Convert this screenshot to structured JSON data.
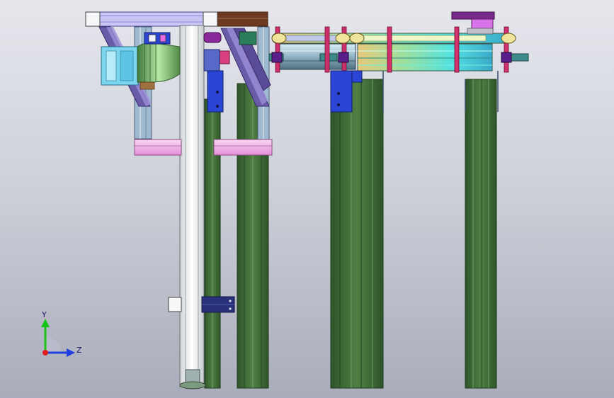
{
  "view": {
    "background_top": "#e6e7ed",
    "background_bottom": "#a9acba"
  },
  "triad": {
    "y_label": "Y",
    "z_label": "Z",
    "y_color": "#19c419",
    "z_color": "#1f3fe0",
    "x_color": "#e01f1f"
  },
  "colors": {
    "column_green": "#3d6b35",
    "frame_white": "#eef0f2",
    "slab_pink": "#f2b4e8",
    "rail_lavender": "#c9c6f5",
    "bracket_blue": "#2b45d6",
    "nut_magenta": "#d0306c",
    "belt_yellow": "#f0e49a",
    "belt_cyan": "#59e6d8",
    "pipe_teal": "#3f8b8b",
    "top_brown": "#6b3a20",
    "purple_block": "#7a2a8a",
    "motor_green": "#6fb06a",
    "motor_cyan": "#7cd6ef"
  }
}
